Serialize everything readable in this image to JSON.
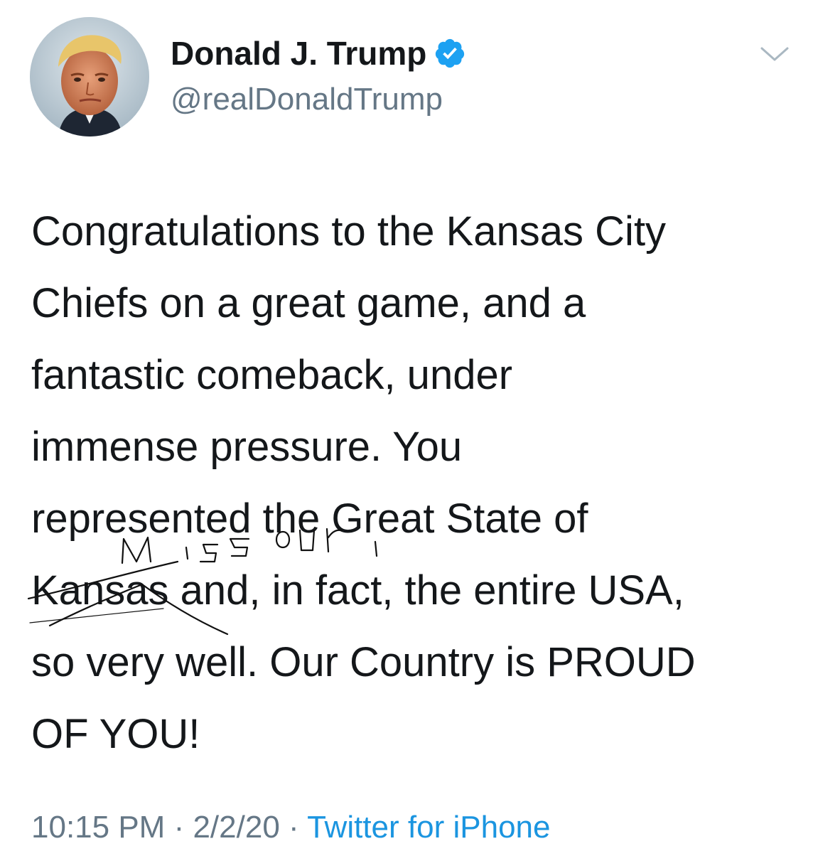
{
  "author": {
    "display_name": "Donald J. Trump",
    "handle": "@realDonaldTrump",
    "verified": true,
    "avatar_icon": "profile-photo"
  },
  "tweet": {
    "lines": [
      "Congratulations to the Kansas City",
      "Chiefs on a great game, and a",
      "fantastic comeback, under",
      "immense pressure. You",
      "represented the Great State of",
      "Kansas and, in fact, the entire USA,",
      "so very well. Our Country is PROUD",
      "OF YOU!"
    ],
    "handwritten_annotation": "Missouri"
  },
  "meta": {
    "time": "10:15 PM",
    "separator": " · ",
    "date": "2/2/20",
    "source": "Twitter for iPhone"
  },
  "colors": {
    "text": "#14171a",
    "secondary": "#657786",
    "link": "#1b95e0",
    "verified": "#1da1f2"
  },
  "icons": {
    "menu": "chevron-down-icon",
    "badge": "verified-badge-icon"
  }
}
